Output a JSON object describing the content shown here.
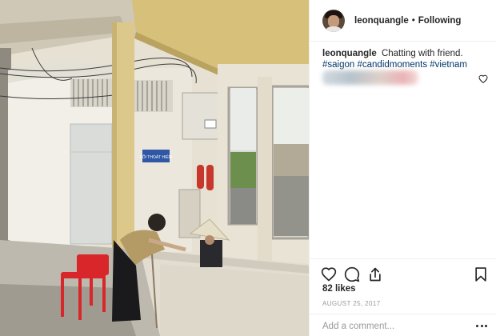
{
  "post": {
    "author": {
      "username": "leonquangle",
      "follow_state": "Following",
      "separator": "•"
    },
    "caption": {
      "text": "Chatting with friend.",
      "hashtags": [
        "#saigon",
        "#candidmoments",
        "#vietnam"
      ]
    },
    "photo": {
      "sign_text": "LỐI THOÁT HIỂM"
    },
    "likes": "82 likes",
    "date": "AUGUST 25, 2017",
    "comment": {
      "placeholder": "Add a comment..."
    }
  },
  "icons": {
    "caption_like": "heart-outline-icon",
    "like": "heart-outline-icon",
    "comment": "speech-bubble-icon",
    "share": "share-arrow-icon",
    "save": "bookmark-icon",
    "more": "ellipsis-icon"
  },
  "colors": {
    "link": "#003569",
    "muted": "#999999",
    "text": "#262626",
    "border": "#efefef"
  }
}
